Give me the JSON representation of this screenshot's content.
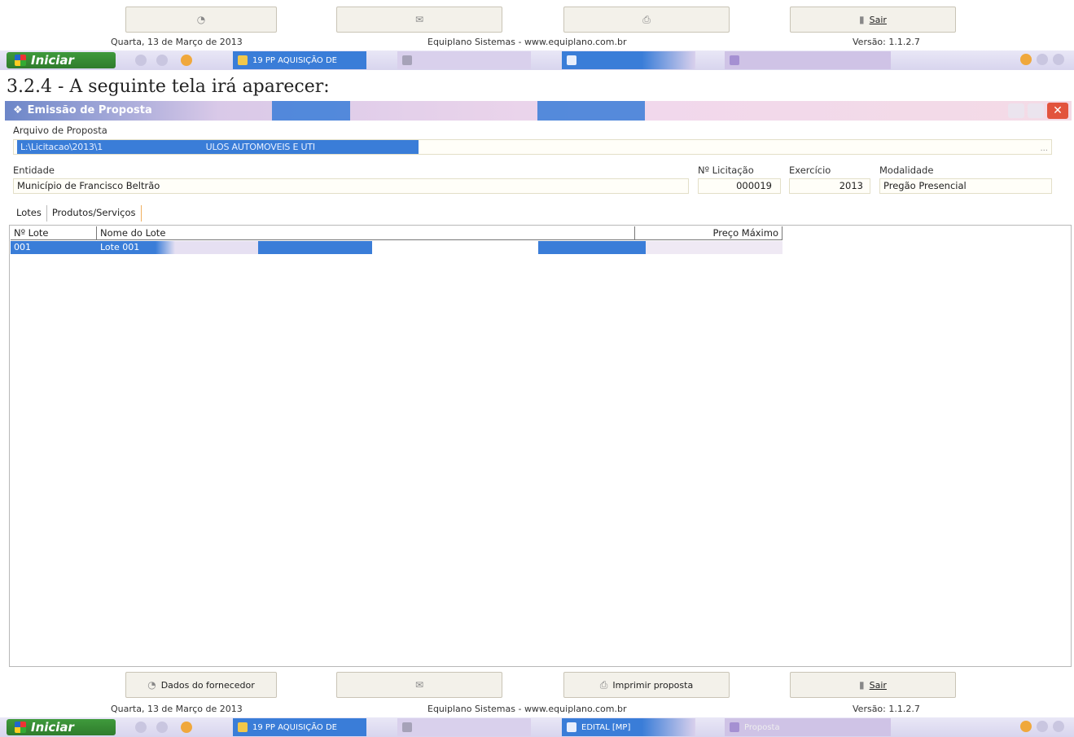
{
  "top_toolbar": {
    "buttons": [
      {
        "label": "Dados do fornecedor",
        "icon": "user-icon"
      },
      {
        "label": "",
        "icon": "mail-icon"
      },
      {
        "label": "Imprimir proposta",
        "icon": "print-icon"
      },
      {
        "label": "Sair",
        "icon": "exit-icon"
      }
    ]
  },
  "status": {
    "date": "Quarta, 13 de Março de 2013",
    "company": "Equiplano Sistemas - www.equiplano.com.br",
    "version": "Versão: 1.1.2.7"
  },
  "taskbar": {
    "start_label": "Iniciar",
    "items": [
      {
        "label": "19 PP AQUISIÇÃO DE",
        "color": "#3a7dd8"
      },
      {
        "label": "",
        "color": "#d9d0ec"
      },
      {
        "label": "EDITAL [MP]",
        "color": "#3a7dd8"
      },
      {
        "label": "Proposta",
        "color": "#cfc3e6"
      }
    ]
  },
  "heading": "3.2.4 - A seguinte tela irá aparecer:",
  "window": {
    "title": "Emissão de Proposta",
    "arquivo_label": "Arquivo de Proposta",
    "arquivo_value_prefix": "L:\\Licitacao\\2013\\1",
    "arquivo_value_mid": "ULOS AUTOMOVEIS E UTI",
    "browse_label": "...",
    "entidade_label": "Entidade",
    "entidade_value": "Município de Francisco Beltrão",
    "licitacao_label": "Nº Licitação",
    "licitacao_value": "000019",
    "exercicio_label": "Exercício",
    "exercicio_value": "2013",
    "modalidade_label": "Modalidade",
    "modalidade_value": "Pregão Presencial",
    "tabs": [
      "Lotes",
      "Produtos/Serviços"
    ],
    "grid": {
      "columns": [
        "Nº Lote",
        "Nome do Lote",
        "Preço Máximo"
      ],
      "rows": [
        {
          "numero": "001",
          "nome": "Lote 001",
          "preco": ""
        }
      ]
    }
  },
  "colors": {
    "selection": "#3a7dd8",
    "start_button": "#2f7c2c",
    "close_button": "#e2533d"
  }
}
